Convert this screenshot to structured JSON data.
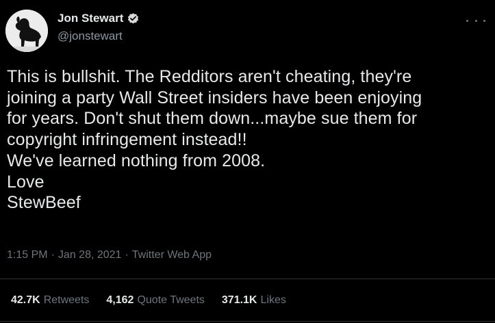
{
  "author": {
    "display_name": "Jon Stewart",
    "handle": "@jonstewart",
    "verified_color": "#d9d9d9",
    "verified_icon": "verified-badge-icon"
  },
  "tweet": {
    "text": "This is bullshit. The Redditors aren't cheating, they're\njoining a party Wall Street insiders have been enjoying\nfor years. Don't shut them down...maybe sue them for\ncopyright infringement instead!!\nWe've learned nothing from 2008.\nLove\nStewBeef"
  },
  "meta": {
    "time": "1:15 PM",
    "separator": "·",
    "date": "Jan 28, 2021",
    "source": "Twitter Web App"
  },
  "stats": {
    "retweets": {
      "count": "42.7K",
      "label": "Retweets"
    },
    "quote_tweets": {
      "count": "4,162",
      "label": "Quote Tweets"
    },
    "likes": {
      "count": "371.1K",
      "label": "Likes"
    }
  },
  "colors": {
    "background": "#000000",
    "primary_text": "#e7e9ea",
    "secondary_text": "#6e767d",
    "divider": "#2f3336"
  }
}
